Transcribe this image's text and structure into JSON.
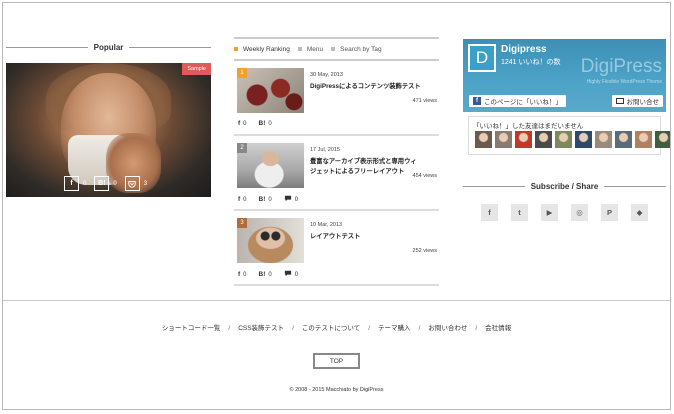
{
  "popular": {
    "heading": "Popular",
    "badge": "Sample",
    "share": {
      "fb_icon": "f",
      "fb_count": "0",
      "hatena_icon": "B!",
      "hatena_count": "0",
      "pocket_count": "3"
    }
  },
  "ranking": {
    "tabs": [
      {
        "label": "Weekly Ranking",
        "active": true
      },
      {
        "label": "Menu",
        "active": false
      },
      {
        "label": "Search by Tag",
        "active": false
      }
    ],
    "items": [
      {
        "rank": "1",
        "date": "30 May, 2013",
        "title": "DigiPressによるコンテンツ装飾テスト",
        "views": "471 views",
        "fb": "0",
        "hatena": "0",
        "comments": null
      },
      {
        "rank": "2",
        "date": "17 Jul, 2015",
        "title": "豊富なアーカイブ表示形式と専用ウィジェットによるフリーレイアウト",
        "views": "454 views",
        "fb": "0",
        "hatena": "0",
        "comments": "0"
      },
      {
        "rank": "3",
        "date": "10 Mar, 2013",
        "title": "レイアウトテスト",
        "views": "252 views",
        "fb": "0",
        "hatena": "0",
        "comments": "0"
      }
    ],
    "fb_icon": "f",
    "hatena_icon": "B!"
  },
  "facebook": {
    "logo_letter": "D",
    "name": "Digipress",
    "likes": "1241 いいね！の数",
    "brand": "DigiPress",
    "tagline": "Highly Flexible WordPress Theme",
    "like_button": "このページに「いいね！」",
    "contact_button": "お問い合せ",
    "friends_text": "「いいね！」した友達はまだいません",
    "avatar_colors": [
      "#6b5a4e",
      "#8a7a70",
      "#c0392b",
      "#4a4a4a",
      "#7b8a5a",
      "#2e4a6b",
      "#9a8a7a",
      "#5a6b7b",
      "#b08060",
      "#3e5e3e",
      "#8e7a6a"
    ]
  },
  "subscribe": {
    "heading": "Subscribe / Share",
    "icons": [
      {
        "name": "facebook-icon",
        "glyph": "f"
      },
      {
        "name": "twitter-icon",
        "glyph": "t"
      },
      {
        "name": "youtube-icon",
        "glyph": "▶"
      },
      {
        "name": "instagram-icon",
        "glyph": "◎"
      },
      {
        "name": "pinterest-icon",
        "glyph": "P"
      },
      {
        "name": "feedly-icon",
        "glyph": "◆"
      }
    ]
  },
  "footer": {
    "nav": [
      "ショートコード一覧",
      "CSS装飾テスト",
      "このテストについて",
      "テーマ購入",
      "お問い合わせ",
      "会社情報"
    ],
    "separator": "/",
    "top_button": "TOP",
    "copyright": "© 2008 - 2015 Macchiato by DigiPress"
  }
}
